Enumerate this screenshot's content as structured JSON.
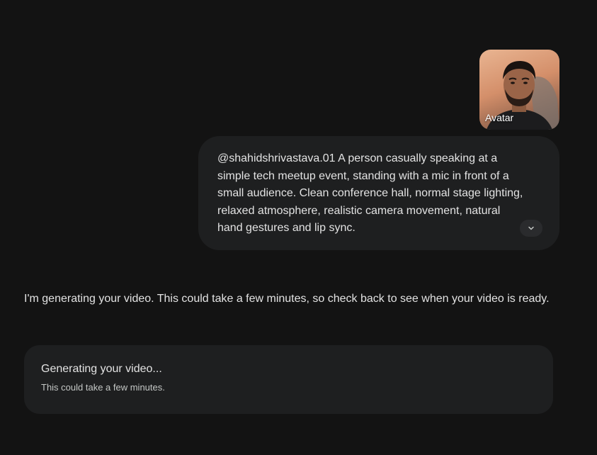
{
  "avatar": {
    "label": "Avatar"
  },
  "prompt": {
    "text": "@shahidshrivastava.01 A person casually speaking at a\nsimple tech meetup event, standing with a mic in front of a\nsmall audience. Clean conference hall, normal stage lighting,\nrelaxed atmosphere, realistic camera movement, natural\nhand gestures and lip sync.",
    "expand_icon": "chevron-down-icon"
  },
  "response": {
    "text": "I'm generating your video. This could take a few minutes, so check back to see when your video is ready."
  },
  "status_card": {
    "title": "Generating your video...",
    "subtitle": "This could take a few minutes."
  },
  "colors": {
    "background": "#131313",
    "surface": "#1e1f20",
    "text_primary": "#e3e3e3",
    "text_secondary": "#c4c7c5"
  }
}
